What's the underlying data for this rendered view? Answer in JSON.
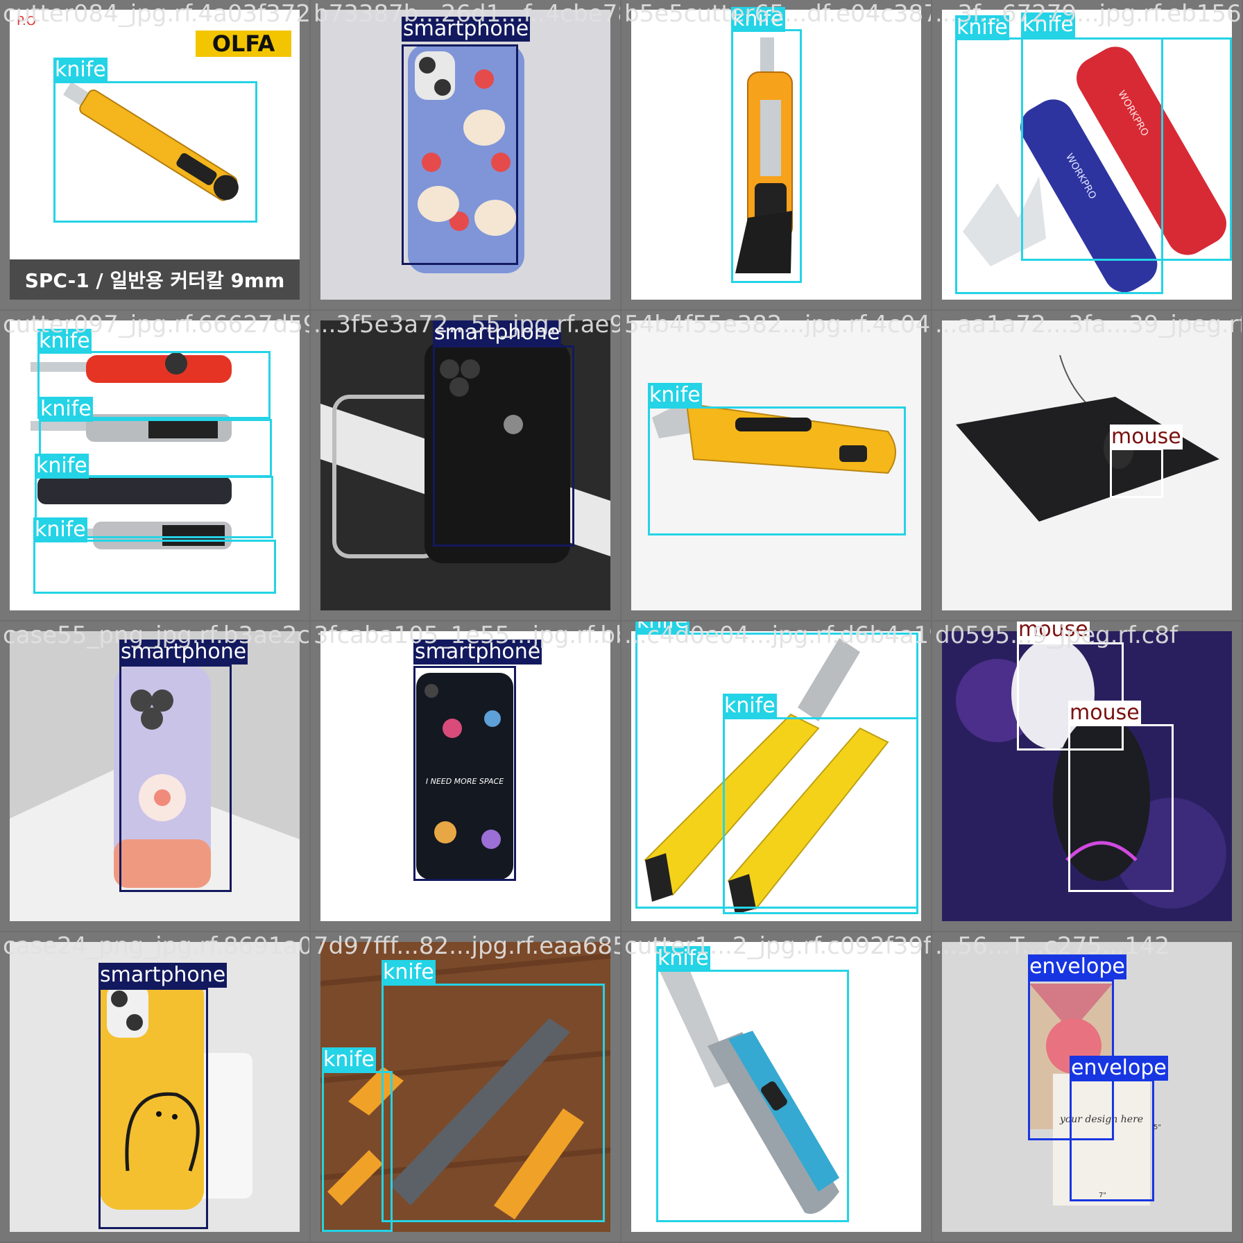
{
  "colors": {
    "knife": "#24d3e6",
    "smartphone": "#13195e",
    "mouse": "#ffffff",
    "envelope": "#1736e2"
  },
  "tiles": [
    {
      "filename": "cutter084_jpg.rf.4a03f372b28",
      "bg": "#ffffff",
      "labels": [
        "knife"
      ],
      "texts": [
        "OLFA",
        "SPC-1 / 일반용 커터칼 9mm",
        "P.O"
      ]
    },
    {
      "filename": "b73387b...26d1...f..4cbe7834e",
      "bg": "#d9d9dd",
      "labels": [
        "smartphone"
      ],
      "texts": []
    },
    {
      "filename": "b5e5cutter65...df.e04c3875bb",
      "bg": "#ffffff",
      "labels": [
        "knife"
      ],
      "texts": []
    },
    {
      "filename": "...3f...67279...jpg.rf.eb1564af",
      "bg": "#ffffff",
      "labels": [
        "knife",
        "knife"
      ],
      "texts": [
        "WORKPRO",
        "WORKPRO"
      ]
    },
    {
      "filename": "cutter097_jpg.rf.66627d590a",
      "bg": "#ffffff",
      "labels": [
        "knife",
        "knife",
        "knife",
        "knife"
      ],
      "texts": []
    },
    {
      "filename": "...3f5e3a72...55_jpg.rf.ae9e...7c",
      "bg": "#2b2b2b",
      "labels": [
        "smartphone"
      ],
      "texts": []
    },
    {
      "filename": "54b4f55e382...jpg.rf.4c04407",
      "bg": "#f5f5f5",
      "labels": [
        "knife"
      ],
      "texts": []
    },
    {
      "filename": "...aa1a72...3fa...39_jpeg.rf.e6",
      "bg": "#f3f3f3",
      "labels": [
        "mouse"
      ],
      "texts": []
    },
    {
      "filename": "case55_png_jpg.rf.b3ae2c47",
      "bg": "#cfcfcf",
      "labels": [
        "smartphone"
      ],
      "texts": []
    },
    {
      "filename": "3fcaba105_1e55...jpg.rf.bbb8860",
      "bg": "#ffffff",
      "labels": [
        "smartphone"
      ],
      "texts": [
        "I NEED MORE SPACE"
      ]
    },
    {
      "filename": "...c4d0e04...jpg.rf.d6b4a19e5",
      "bg": "#ffffff",
      "labels": [
        "knife",
        "knife"
      ],
      "texts": []
    },
    {
      "filename": "d0595...9_jpeg.rf.c8f",
      "bg": "#2a1f5e",
      "labels": [
        "mouse",
        "mouse"
      ],
      "texts": []
    },
    {
      "filename": "case24_png_jpg.rf.8691a079",
      "bg": "#e6e6e6",
      "labels": [
        "smartphone"
      ],
      "texts": []
    },
    {
      "filename": "7d97fff...82...jpg.rf.eaa685d2",
      "bg": "#7b4a2a",
      "labels": [
        "knife",
        "knife"
      ],
      "texts": []
    },
    {
      "filename": "cutter1...2_jpg.rf.c092f39fd68",
      "bg": "#ffffff",
      "labels": [
        "knife"
      ],
      "texts": []
    },
    {
      "filename": "...56...T...c275...142",
      "bg": "#d8d8d8",
      "labels": [
        "envelope",
        "envelope"
      ],
      "texts": [
        "your design here",
        "5\"",
        "7\""
      ]
    }
  ]
}
